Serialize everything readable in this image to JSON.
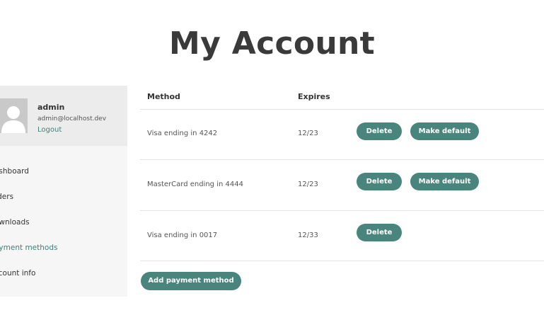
{
  "page": {
    "title": "My Account"
  },
  "user": {
    "name": "admin",
    "email": "admin@localhost.dev",
    "logout_label": "Logout"
  },
  "nav": {
    "items": [
      {
        "label": "ashboard",
        "active": false
      },
      {
        "label": "rders",
        "active": false
      },
      {
        "label": "ownloads",
        "active": false
      },
      {
        "label": "ayment methods",
        "active": true
      },
      {
        "label": "ccount info",
        "active": false
      }
    ],
    "active_color": "#3f7f77"
  },
  "table": {
    "headers": {
      "method": "Method",
      "expires": "Expires"
    },
    "rows": [
      {
        "method": "Visa ending in 4242",
        "expires": "12/23",
        "delete_label": "Delete",
        "make_default_label": "Make default"
      },
      {
        "method": "MasterCard ending in 4444",
        "expires": "12/23",
        "delete_label": "Delete",
        "make_default_label": "Make default"
      },
      {
        "method": "Visa ending in 0017",
        "expires": "12/33",
        "delete_label": "Delete"
      }
    ]
  },
  "add_payment_method_label": "Add payment method",
  "colors": {
    "accent": "#4a857d",
    "sidebar_bg": "#f6f6f6",
    "user_card_bg": "#ececec"
  }
}
